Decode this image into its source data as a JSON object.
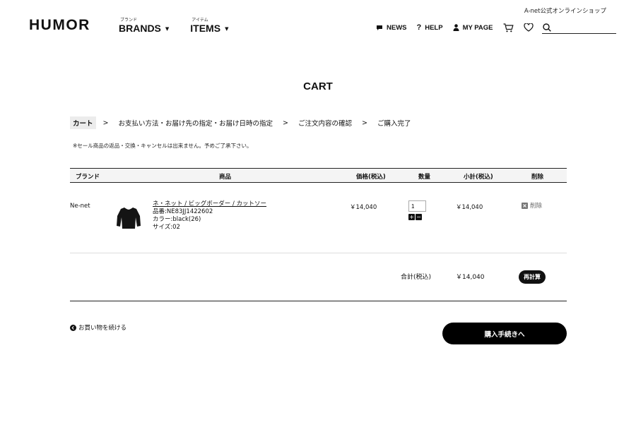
{
  "header": {
    "tagline": "A-net公式オンラインショップ",
    "logo": "HUMOR",
    "nav": [
      {
        "ruby": "ブランド",
        "label": "BRANDS"
      },
      {
        "ruby": "アイテム",
        "label": "ITEMS"
      }
    ],
    "util": {
      "news": "NEWS",
      "help": "HELP",
      "mypage": "MY PAGE"
    },
    "search": {
      "value": "",
      "placeholder": ""
    }
  },
  "page": {
    "title": "CART",
    "steps": [
      "カート",
      "お支払い方法・お届け先の指定・お届け日時の指定",
      "ご注文内容の確認",
      "ご購入完了"
    ],
    "step_separator": ">",
    "notice": "※セール商品の返品・交換・キャンセルは出来ません。予めご了承下さい。"
  },
  "cart": {
    "columns": {
      "brand": "ブランド",
      "product": "商品",
      "price": "価格(税込)",
      "qty": "数量",
      "subtotal": "小計(税込)",
      "remove": "削除"
    },
    "items": [
      {
        "brand": "Ne-net",
        "name": "ネ・ネット / ビッグボーダー / カットソー",
        "code": "品番:NE83JJ1422602",
        "color": "カラー:black(26)",
        "size": "サイズ:02",
        "price": "￥14,040",
        "qty": "1",
        "subtotal": "￥14,040",
        "remove_label": "削除"
      }
    ],
    "total_label": "合計(税込)",
    "total_value": "￥14,040",
    "recalc_label": "再計算"
  },
  "actions": {
    "continue_label": "お買い物を続ける",
    "checkout_label": "購入手続きへ"
  }
}
